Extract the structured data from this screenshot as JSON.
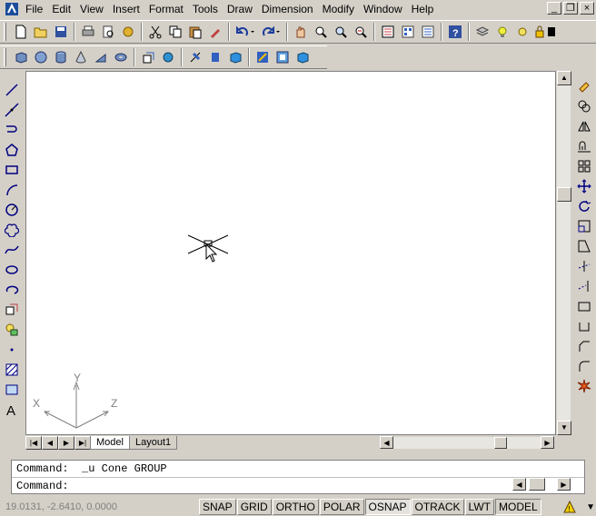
{
  "menu": {
    "items": [
      "File",
      "Edit",
      "View",
      "Insert",
      "Format",
      "Tools",
      "Draw",
      "Dimension",
      "Modify",
      "Window",
      "Help"
    ],
    "window_controls": [
      "_",
      "❐",
      "×"
    ]
  },
  "toolbars": {
    "standard_icons": [
      "new-icon",
      "open-icon",
      "save-icon",
      "print-icon",
      "print-preview-icon",
      "publish-icon",
      "cut-icon",
      "copy-icon",
      "paste-icon",
      "match-properties-icon",
      "undo-icon",
      "redo-icon",
      "pan-icon",
      "zoom-realtime-icon",
      "zoom-window-icon",
      "zoom-previous-icon",
      "properties-icon",
      "design-center-icon",
      "tool-palettes-icon",
      "help-icon"
    ],
    "modeling_icons": [
      "box-icon",
      "sphere-icon",
      "cylinder-icon",
      "cone-icon",
      "wedge-icon",
      "torus-icon",
      "extrude-icon",
      "revolve-icon",
      "slice-icon",
      "section-icon",
      "interference-icon",
      "setup-drawing-icon",
      "setup-view-icon",
      "setup-profile-icon"
    ]
  },
  "draw_toolbar": [
    "line-icon",
    "construction-line-icon",
    "polyline-icon",
    "polygon-icon",
    "rectangle-icon",
    "arc-icon",
    "circle-icon",
    "revision-cloud-icon",
    "spline-icon",
    "ellipse-icon",
    "ellipse-arc-icon",
    "insert-block-icon",
    "make-block-icon",
    "point-icon",
    "hatch-icon",
    "region-icon",
    "multiline-text-icon"
  ],
  "modify_toolbar": [
    "erase-icon",
    "copy-object-icon",
    "mirror-icon",
    "offset-icon",
    "array-icon",
    "move-icon",
    "rotate-icon",
    "scale-icon",
    "stretch-icon",
    "trim-icon",
    "extend-icon",
    "break-at-point-icon",
    "break-icon",
    "chamfer-icon",
    "fillet-icon",
    "explode-icon"
  ],
  "ucs": {
    "x_label": "X",
    "y_label": "Y",
    "z_label": "Z"
  },
  "tabs": {
    "model": "Model",
    "layout1": "Layout1"
  },
  "command": {
    "history": "Command:  _u Cone GROUP",
    "prompt": "Command:"
  },
  "status": {
    "coordinates": "19.0131, -2.6410, 0.0000",
    "toggles": [
      "SNAP",
      "GRID",
      "ORTHO",
      "POLAR",
      "OSNAP",
      "OTRACK",
      "LWT",
      "MODEL"
    ]
  }
}
